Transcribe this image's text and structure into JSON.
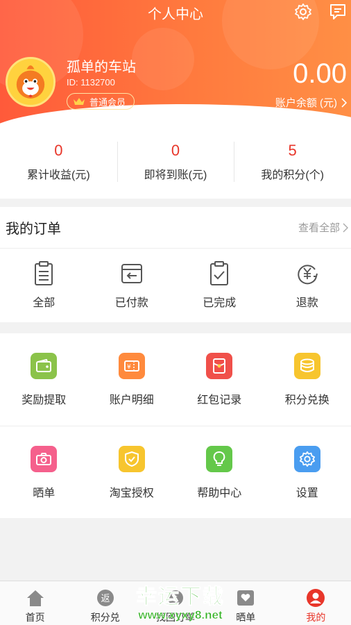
{
  "header": {
    "title": "个人中心",
    "settings_icon": "gear-icon",
    "message_icon": "message-icon",
    "username": "孤单的车站",
    "user_id": "ID: 1132700",
    "member_level": "普通会员",
    "balance": "0.00",
    "balance_label": "账户余额 (元)"
  },
  "stats": [
    {
      "value": "0",
      "label": "累计收益(元)"
    },
    {
      "value": "0",
      "label": "即将到账(元)"
    },
    {
      "value": "5",
      "label": "我的积分(个)"
    }
  ],
  "orders": {
    "title": "我的订单",
    "view_all": "查看全部",
    "items": [
      {
        "label": "全部",
        "icon": "clipboard-icon"
      },
      {
        "label": "已付款",
        "icon": "payment-return-icon"
      },
      {
        "label": "已完成",
        "icon": "check-clipboard-icon"
      },
      {
        "label": "退款",
        "icon": "yen-refund-icon"
      }
    ]
  },
  "services": {
    "row1": [
      {
        "label": "奖励提取",
        "icon": "wallet-icon",
        "color": "#8bc34a"
      },
      {
        "label": "账户明细",
        "icon": "ticket-icon",
        "color": "#ff8a3d"
      },
      {
        "label": "红包记录",
        "icon": "red-envelope-icon",
        "color": "#f0504a"
      },
      {
        "label": "积分兑换",
        "icon": "coins-icon",
        "color": "#f7c52e"
      }
    ],
    "row2": [
      {
        "label": "晒单",
        "icon": "camera-icon",
        "color": "#f5608c"
      },
      {
        "label": "淘宝授权",
        "icon": "shield-check-icon",
        "color": "#f7c52e"
      },
      {
        "label": "帮助中心",
        "icon": "lightbulb-icon",
        "color": "#64c84a"
      },
      {
        "label": "设置",
        "icon": "gear-icon",
        "color": "#4a9df0"
      }
    ]
  },
  "bottom_nav": [
    {
      "label": "首页",
      "icon": "home-icon"
    },
    {
      "label": "积分兑",
      "icon": "return-badge-icon",
      "badge": "返"
    },
    {
      "label": "找回订单",
      "icon": "find-order-icon"
    },
    {
      "label": "晒单",
      "icon": "heart-photo-icon"
    },
    {
      "label": "我的",
      "icon": "user-icon",
      "active": true
    }
  ],
  "watermark": {
    "title": "幸运下载",
    "url": "www.xyxy8.net"
  },
  "colors": {
    "accent": "#e8362a",
    "header_start": "#ff5a3a",
    "header_end": "#ff8f45"
  }
}
